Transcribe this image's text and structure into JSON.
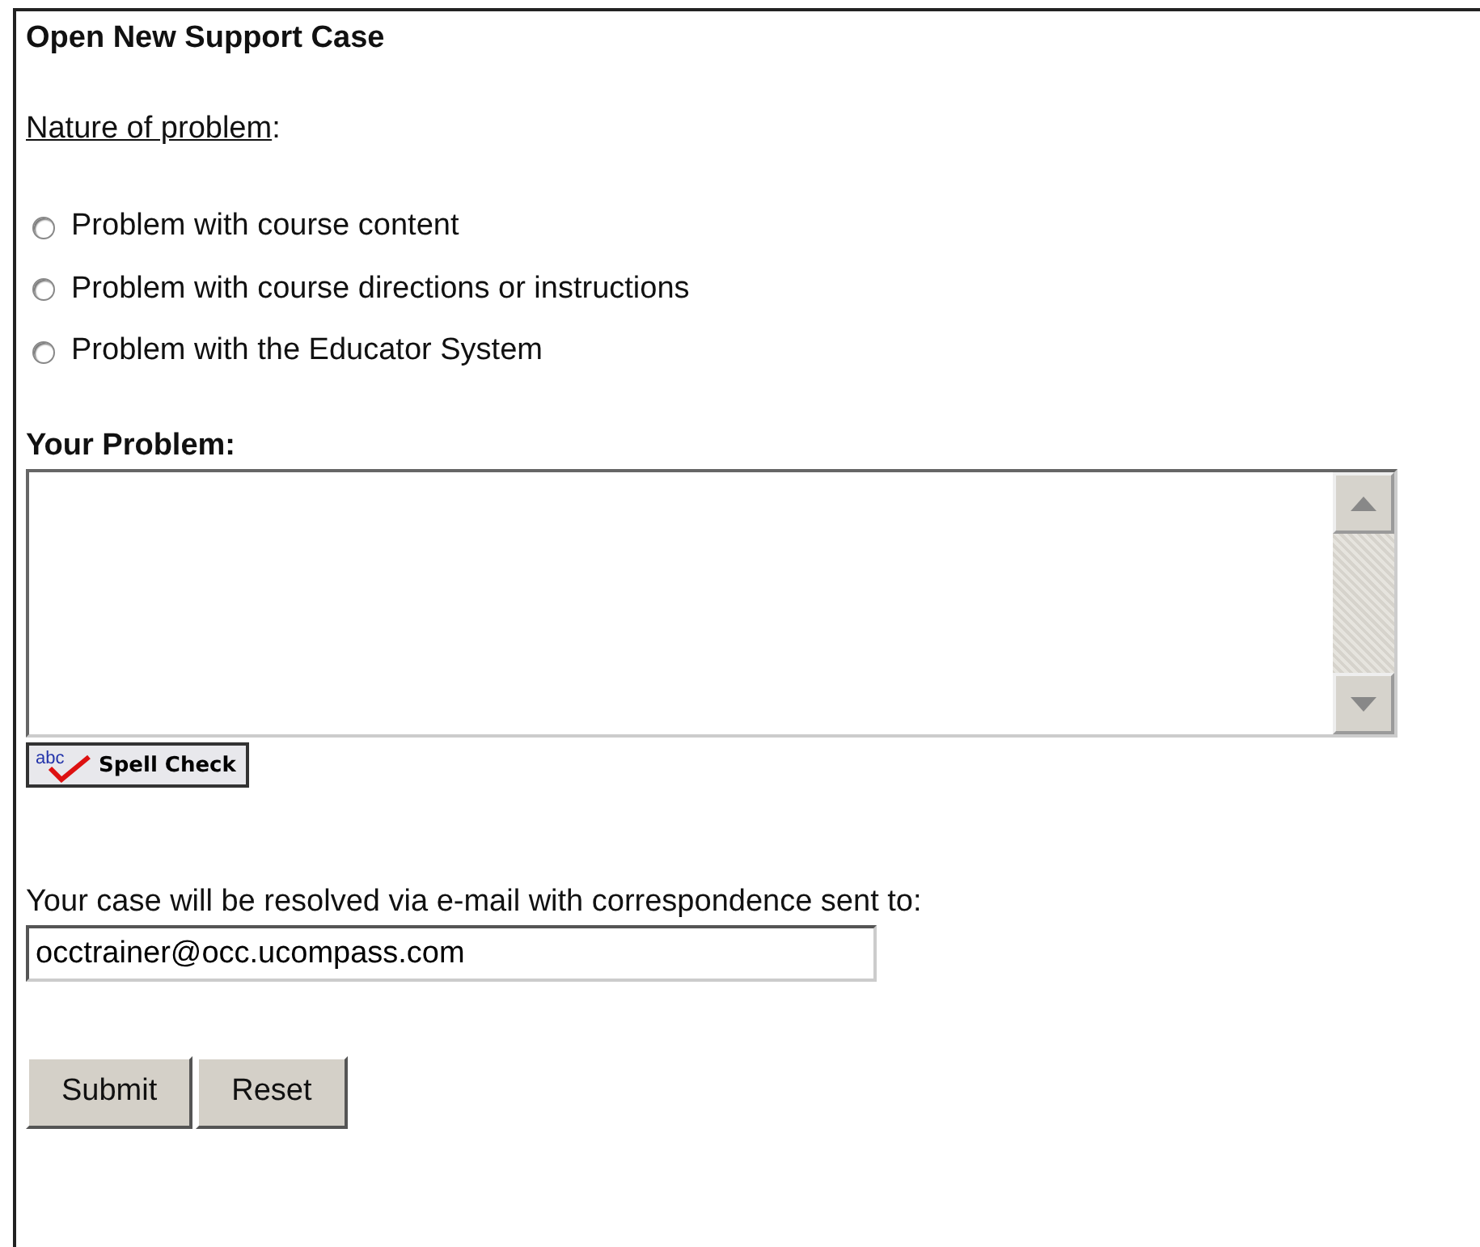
{
  "title": "Open New Support Case",
  "nature_label": "Nature of problem",
  "nature_colon": ":",
  "options": [
    {
      "label": "Problem with course content",
      "selected": false
    },
    {
      "label": "Problem with course directions or instructions",
      "selected": false
    },
    {
      "label": "Problem with the Educator System",
      "selected": false
    }
  ],
  "problem_label": "Your Problem",
  "problem_colon": ":",
  "spell_check": {
    "label": "Spell Check",
    "icon_text": "abc"
  },
  "email_note": "Your case will be resolved via e-mail with correspondence sent to:",
  "email": {
    "value": "occtrainer@occ.ucompass.com"
  },
  "buttons": [
    "Submit",
    "Reset"
  ]
}
